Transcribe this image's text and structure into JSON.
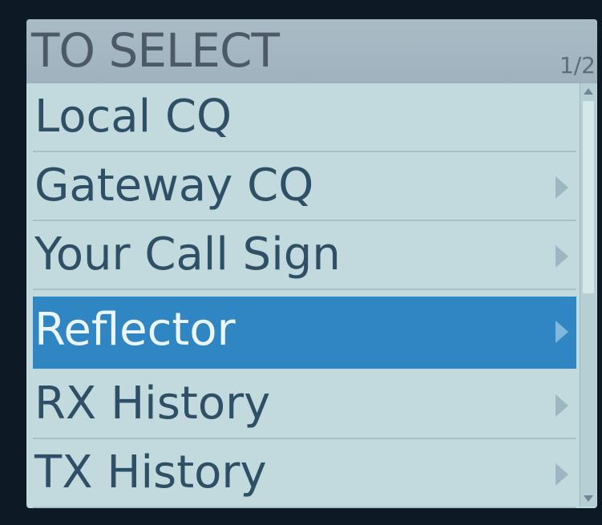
{
  "header": {
    "title": "TO SELECT",
    "page_indicator": "1/2"
  },
  "menu": {
    "items": [
      {
        "label": "Local CQ",
        "has_submenu": false,
        "selected": false
      },
      {
        "label": "Gateway CQ",
        "has_submenu": true,
        "selected": false
      },
      {
        "label": "Your Call Sign",
        "has_submenu": true,
        "selected": false
      },
      {
        "label": "Reflector",
        "has_submenu": true,
        "selected": true
      },
      {
        "label": "RX History",
        "has_submenu": true,
        "selected": false
      },
      {
        "label": "TX History",
        "has_submenu": true,
        "selected": false
      }
    ],
    "current_page": 1,
    "total_pages": 2
  },
  "icons": {
    "submenu": "chevron-right-icon",
    "scroll_up": "triangle-up-icon",
    "scroll_down": "triangle-down-icon"
  },
  "colors": {
    "screen_background": "#c2dadd",
    "header_background": "#a9bcc6",
    "selection_highlight": "#2f86c3",
    "item_text": "#2f4f66",
    "selected_text": "#eaf6fb"
  }
}
